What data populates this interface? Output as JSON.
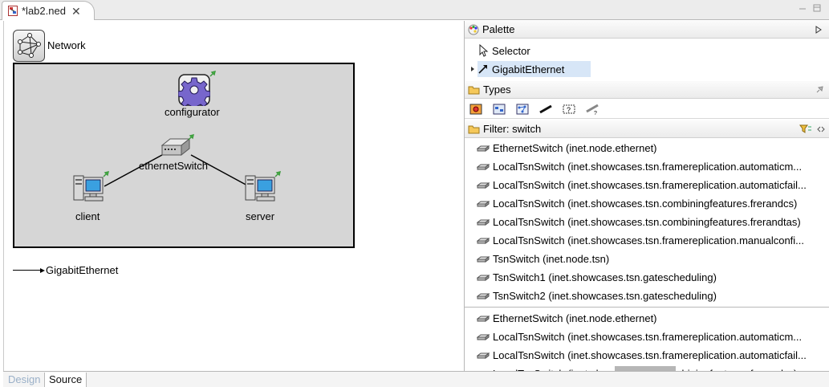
{
  "editor_tab": {
    "title": "*lab2.ned",
    "close": "✕"
  },
  "network": {
    "label": "Network"
  },
  "nodes": {
    "configurator": "configurator",
    "switch": "ethernetSwitch",
    "client": "client",
    "server": "server"
  },
  "link_legend": "GigabitEthernet",
  "bottom_tabs": {
    "design": "Design",
    "source": "Source"
  },
  "palette": {
    "title": "Palette",
    "items": [
      {
        "label": "Selector"
      },
      {
        "label": "GigabitEthernet"
      }
    ]
  },
  "types": {
    "title": "Types"
  },
  "filter": {
    "title": "Filter: switch"
  },
  "filter_results": [
    "EthernetSwitch (inet.node.ethernet)",
    "LocalTsnSwitch (inet.showcases.tsn.framereplication.automaticm...",
    "LocalTsnSwitch (inet.showcases.tsn.framereplication.automaticfail...",
    "LocalTsnSwitch (inet.showcases.tsn.combiningfeatures.frerandcs)",
    "LocalTsnSwitch (inet.showcases.tsn.combiningfeatures.frerandtas)",
    "LocalTsnSwitch (inet.showcases.tsn.framereplication.manualconfi...",
    "TsnSwitch (inet.node.tsn)",
    "TsnSwitch1 (inet.showcases.tsn.gatescheduling)",
    "TsnSwitch2 (inet.showcases.tsn.gatescheduling)"
  ],
  "second_results": [
    "EthernetSwitch (inet.node.ethernet)",
    "LocalTsnSwitch (inet.showcases.tsn.framereplication.automaticm...",
    "LocalTsnSwitch (inet.showcases.tsn.framereplication.automaticfail...",
    "LocalTsnSwitch (inet.showcases.tsn.combiningfeatures.frerandcs)"
  ]
}
